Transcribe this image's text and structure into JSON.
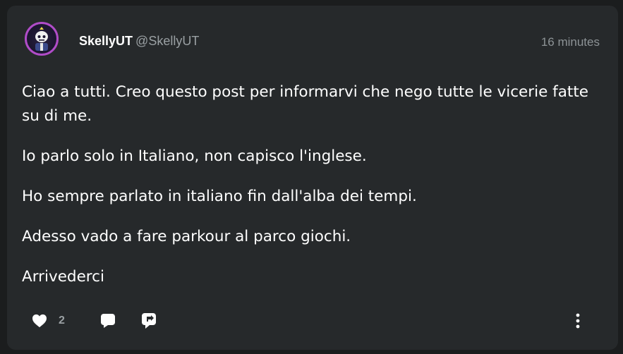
{
  "post": {
    "author_name": "SkellyUT",
    "author_handle": "@SkellyUT",
    "timestamp": "16 minutes",
    "paragraphs": [
      "Ciao a tutti. Creo questo post per informarvi che nego tutte le vicerie fatte su di me.",
      "Io parlo solo in Italiano, non capisco l'inglese.",
      "Ho sempre parlato in italiano fin dall'alba dei tempi.",
      "Adesso vado a fare parkour al parco giochi.",
      "Arrivederci"
    ]
  },
  "actions": {
    "like_count": "2",
    "icons": [
      "heart-icon",
      "comment-icon",
      "share-icon",
      "more-vertical-icon"
    ]
  },
  "colors": {
    "background": "#1b1d1e",
    "card": "#26292b",
    "text": "#ffffff",
    "muted": "#9aa0a3",
    "avatar_ring": "#b04cc8"
  }
}
